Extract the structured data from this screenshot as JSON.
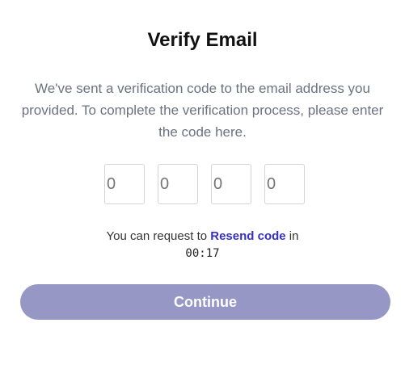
{
  "title": "Verify Email",
  "description": "We've sent a verification code to the email address you provided. To complete the verification process, please enter the code here.",
  "code_inputs": [
    {
      "placeholder": "0"
    },
    {
      "placeholder": "0"
    },
    {
      "placeholder": "0"
    },
    {
      "placeholder": "0"
    }
  ],
  "resend": {
    "prefix": "You can request to ",
    "link_label": "Resend code",
    "suffix": " in",
    "timer": "00:17"
  },
  "continue_label": "Continue",
  "colors": {
    "accent_link": "#3730c4",
    "button_bg": "#9797c5",
    "body_text": "#6b7280"
  }
}
